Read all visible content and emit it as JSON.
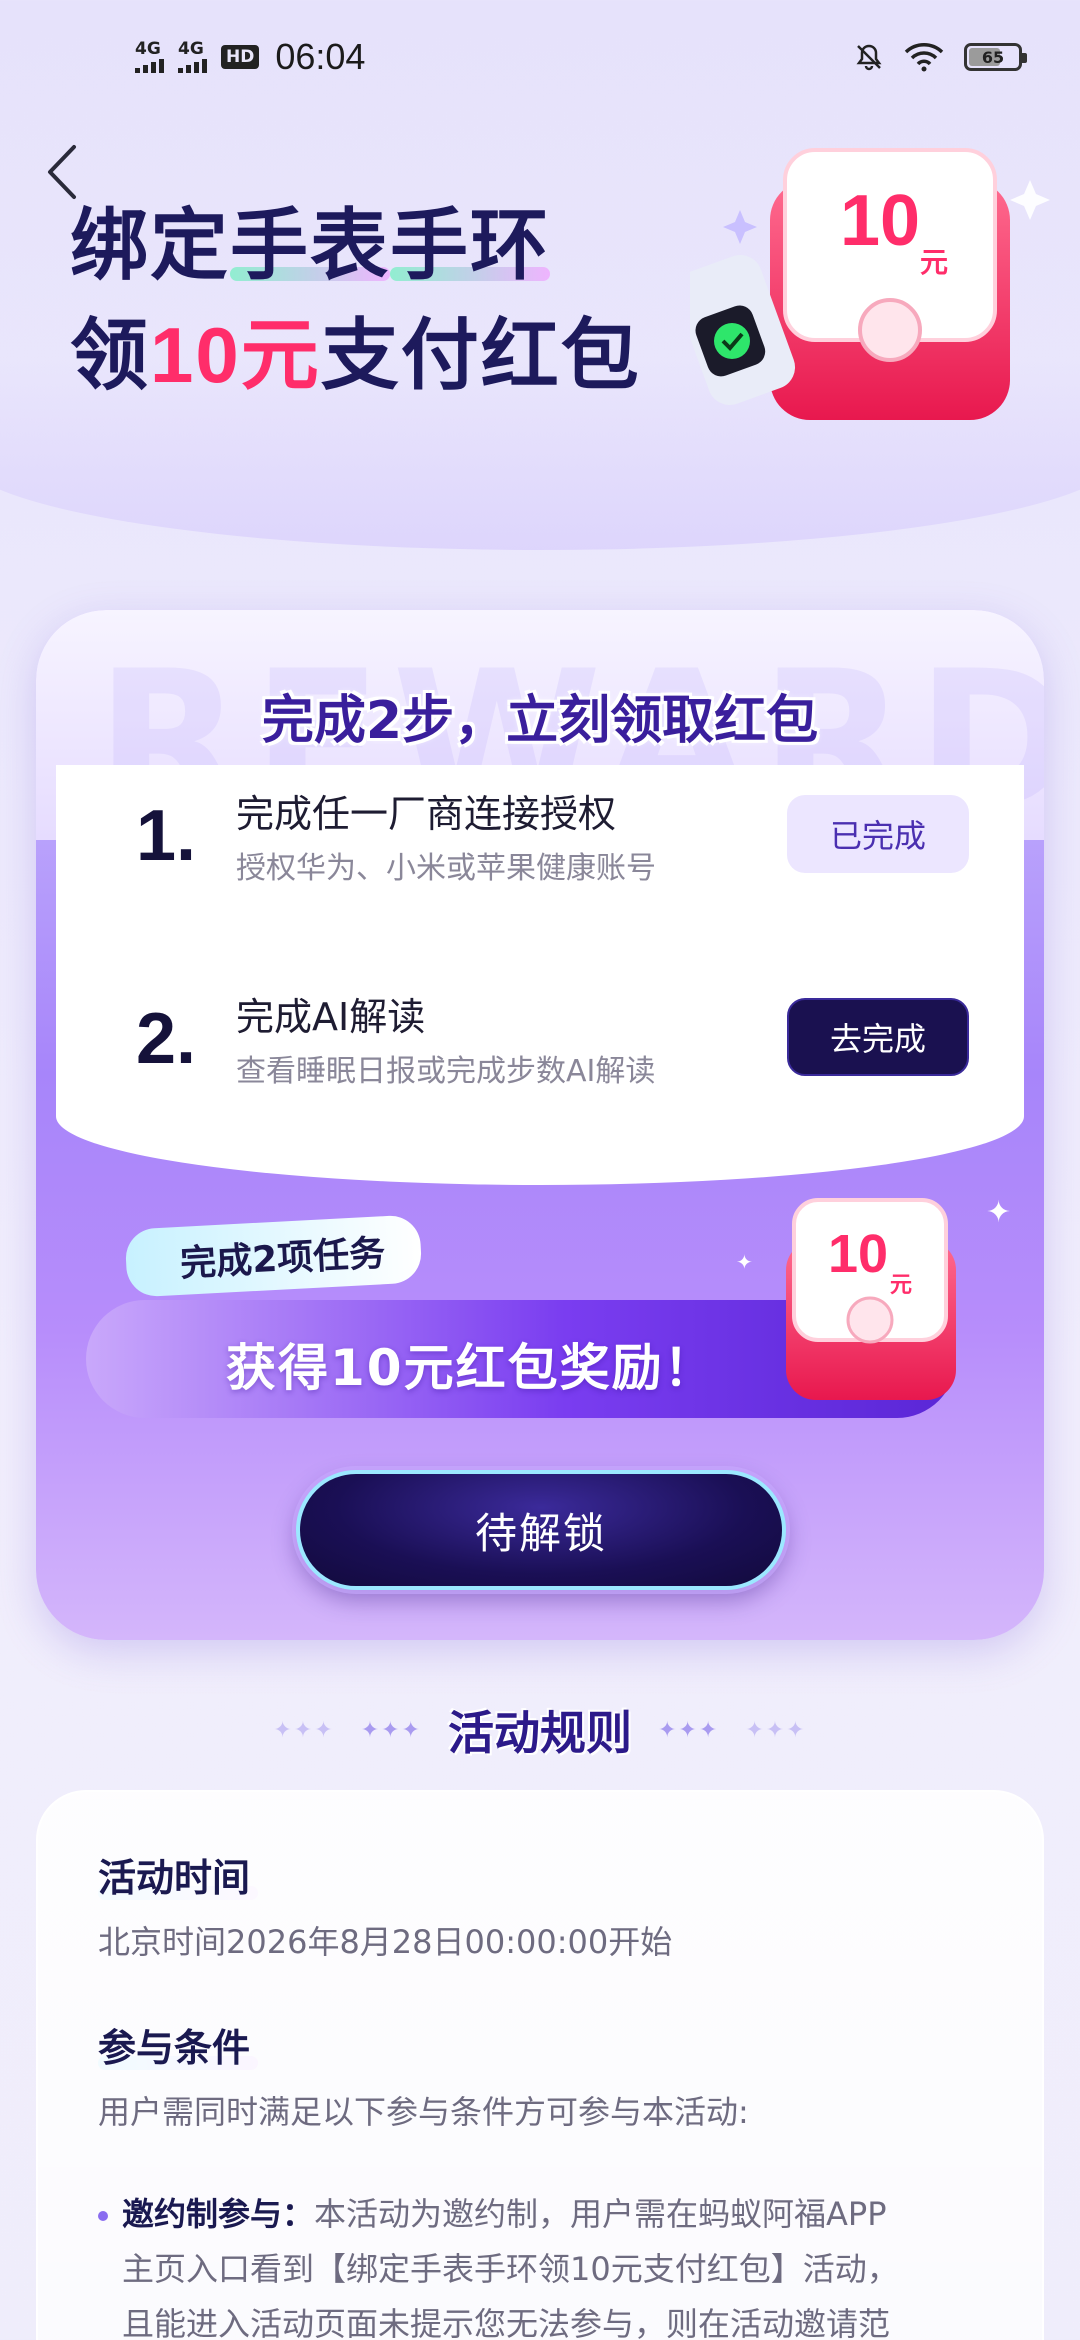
{
  "status_bar": {
    "signal1": "4G",
    "signal2": "4G",
    "hd": "HD",
    "time": "06:04",
    "battery": "65"
  },
  "hero": {
    "line1_a": "绑定",
    "line1_b": "手表",
    "line1_c": "手环",
    "line2_a": "领",
    "line2_b": "10元",
    "line2_c": "支付红包",
    "badge_amount": "10",
    "badge_unit": "元"
  },
  "task_card": {
    "watermark": "REWARD",
    "title": "完成2步，立刻领取红包",
    "tasks": [
      {
        "num": "1.",
        "title": "完成任一厂商连接授权",
        "sub": "授权华为、小米或苹果健康账号",
        "button": "已完成"
      },
      {
        "num": "2.",
        "title": "完成AI解读",
        "sub": "查看睡眠日报或完成步数AI解读",
        "button": "去完成"
      }
    ],
    "reward_tag": "完成2项任务",
    "reward_text": "获得10元红包奖励！",
    "reward_amount": "10",
    "reward_unit": "元",
    "unlock_button": "待解锁"
  },
  "rules": {
    "heading": "活动规则",
    "time_title": "活动时间",
    "time_text": "北京时间2026年8月28日00:00:00开始",
    "cond_title": "参与条件",
    "cond_text": "用户需同时满足以下参与条件方可参与本活动:",
    "bullet_label": "邀约制参与：",
    "bullet_line1": "本活动为邀约制，用户需在蚂蚁阿福APP",
    "bullet_line2": "主页入口看到【绑定手表手环领10元支付红包】活动，",
    "bullet_line3": "且能进入活动页面未提示您无法参与，则在活动邀请范"
  },
  "colors": {
    "accent_dark": "#1a1150",
    "accent_purple": "#7a3df0",
    "red": "#ff2d6a"
  }
}
